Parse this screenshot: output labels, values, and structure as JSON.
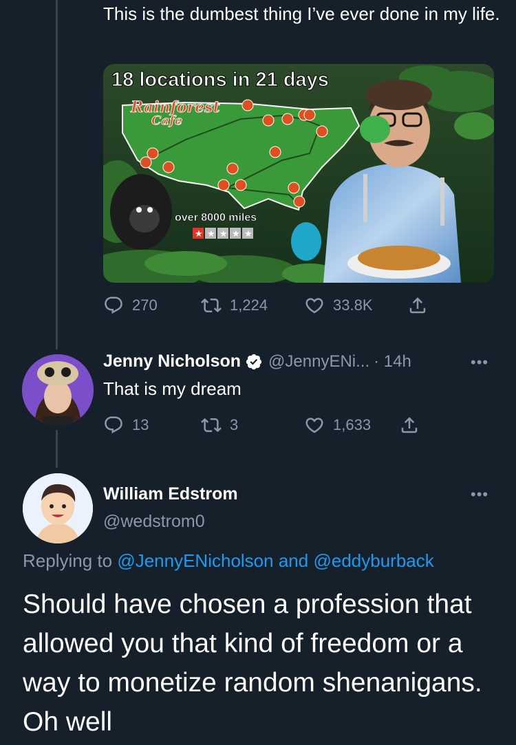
{
  "tweet1": {
    "text": "This is the dumbest thing I’ve ever done in my life.",
    "media": {
      "headline": "18 locations in 21 days",
      "logo_line1": "Rainforest",
      "logo_line2": "Cafe",
      "caption": "over 8000 miles",
      "rating_stars": 1,
      "rating_max": 5
    },
    "stats": {
      "replies": "270",
      "retweets": "1,224",
      "likes": "33.8K"
    }
  },
  "reply1": {
    "name": "Jenny Nicholson",
    "verified": true,
    "handle": "@JennyENi...",
    "time": "· 14h",
    "more": "•••",
    "text": "That is my dream",
    "stats": {
      "replies": "13",
      "retweets": "3",
      "likes": "1,633"
    }
  },
  "main": {
    "name": "William Edstrom",
    "handle": "@wedstrom0",
    "more": "•••",
    "replying_prefix": "Replying to",
    "replying_user1": "@JennyENicholson",
    "replying_and": "and",
    "replying_user2": "@eddyburback",
    "text": "Should have chosen a profession that allowed you that kind of freedom or a way to monetize random shenanigans. Oh well"
  },
  "colors": {
    "background": "#15202b",
    "secondary_text": "#8b98a5",
    "link": "#1d9bf0",
    "thread_line": "#38444d",
    "verified": "#ffffff"
  },
  "icons": [
    "reply-icon",
    "retweet-icon",
    "like-icon",
    "share-icon",
    "verified-badge-icon",
    "more-icon"
  ]
}
